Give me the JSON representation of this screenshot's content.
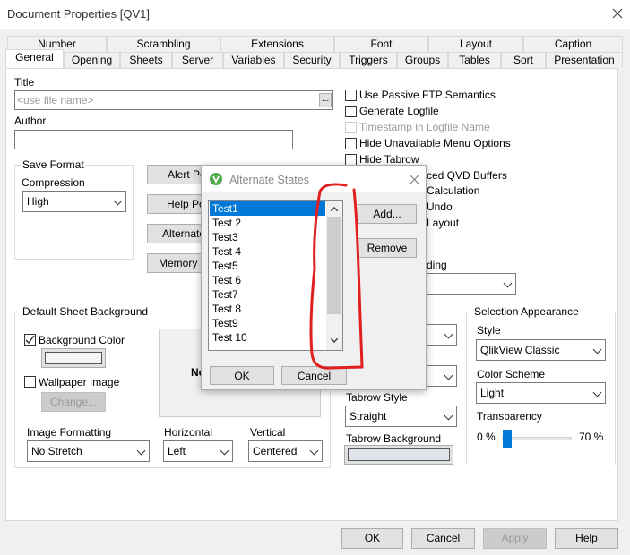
{
  "window": {
    "title": "Document Properties [QV1]",
    "close_icon": "close-icon"
  },
  "tabs": {
    "row1": [
      "Number",
      "Scrambling",
      "Extensions",
      "Font",
      "Layout",
      "Caption"
    ],
    "row2": [
      "General",
      "Opening",
      "Sheets",
      "Server",
      "Variables",
      "Security",
      "Triggers",
      "Groups",
      "Tables",
      "Sort",
      "Presentation"
    ],
    "selected": "General"
  },
  "general": {
    "title_label": "Title",
    "title_placeholder": "<use file name>",
    "browse_label": "...",
    "author_label": "Author",
    "author_value": "",
    "save_format": {
      "label": "Save Format",
      "compression_label": "Compression",
      "compression_value": "High"
    },
    "buttons": [
      "Alert Pop",
      "Help Pop",
      "Alternate",
      "Memory St"
    ],
    "checkboxes": [
      {
        "label": "Use Passive FTP Semantics",
        "checked": false,
        "disabled": false
      },
      {
        "label": "Generate Logfile",
        "checked": false,
        "disabled": false
      },
      {
        "label": "Timestamp in Logfile Name",
        "checked": false,
        "disabled": true
      },
      {
        "label": "Hide Unavailable Menu Options",
        "checked": false,
        "disabled": false
      },
      {
        "label": "Hide Tabrow",
        "checked": false,
        "disabled": false
      },
      {
        "label": "ced QVD Buffers"
      },
      {
        "label": "Calculation"
      },
      {
        "label": "Undo"
      },
      {
        "label": "Layout"
      }
    ],
    "partial_label": "ding",
    "sheet_background": {
      "label": "Default Sheet Background",
      "background_color_label": "Background Color",
      "background_color_checked": true,
      "wallpaper_label": "Wallpaper Image",
      "wallpaper_checked": false,
      "change_label": "Change...",
      "preview_text": "No",
      "image_formatting_label": "Image Formatting",
      "image_formatting_value": "No Stretch",
      "horizontal_label": "Horizontal",
      "horizontal_value": "Left",
      "vertical_label": "Vertical",
      "vertical_value": "Centered"
    },
    "tabrow_style_label": "Tabrow Style",
    "tabrow_style_value": "Straight",
    "tabrow_background_label": "Tabrow Background",
    "selection_appearance": {
      "label": "Selection Appearance",
      "style_label": "Style",
      "style_value": "QlikView Classic",
      "color_scheme_label": "Color Scheme",
      "color_scheme_value": "Light",
      "transparency_label": "Transparency",
      "min_label": "0 %",
      "max_label": "70 %",
      "transparency_value_percent": 0
    }
  },
  "footer": {
    "ok": "OK",
    "cancel": "Cancel",
    "apply": "Apply",
    "help": "Help"
  },
  "dialog": {
    "title": "Alternate States",
    "icon": "qlikview-logo-icon",
    "states": [
      "Test1",
      "Test 2",
      "Test3",
      "Test 4",
      "Test5",
      "Test 6",
      "Test7",
      "Test 8",
      "Test9",
      "Test 10"
    ],
    "selected": "Test1",
    "add": "Add...",
    "remove": "Remove",
    "ok": "OK",
    "cancel": "Cancel"
  },
  "colors": {
    "selection": "#0078d7",
    "annotation": "#e02020",
    "logo": "#52a94b"
  }
}
